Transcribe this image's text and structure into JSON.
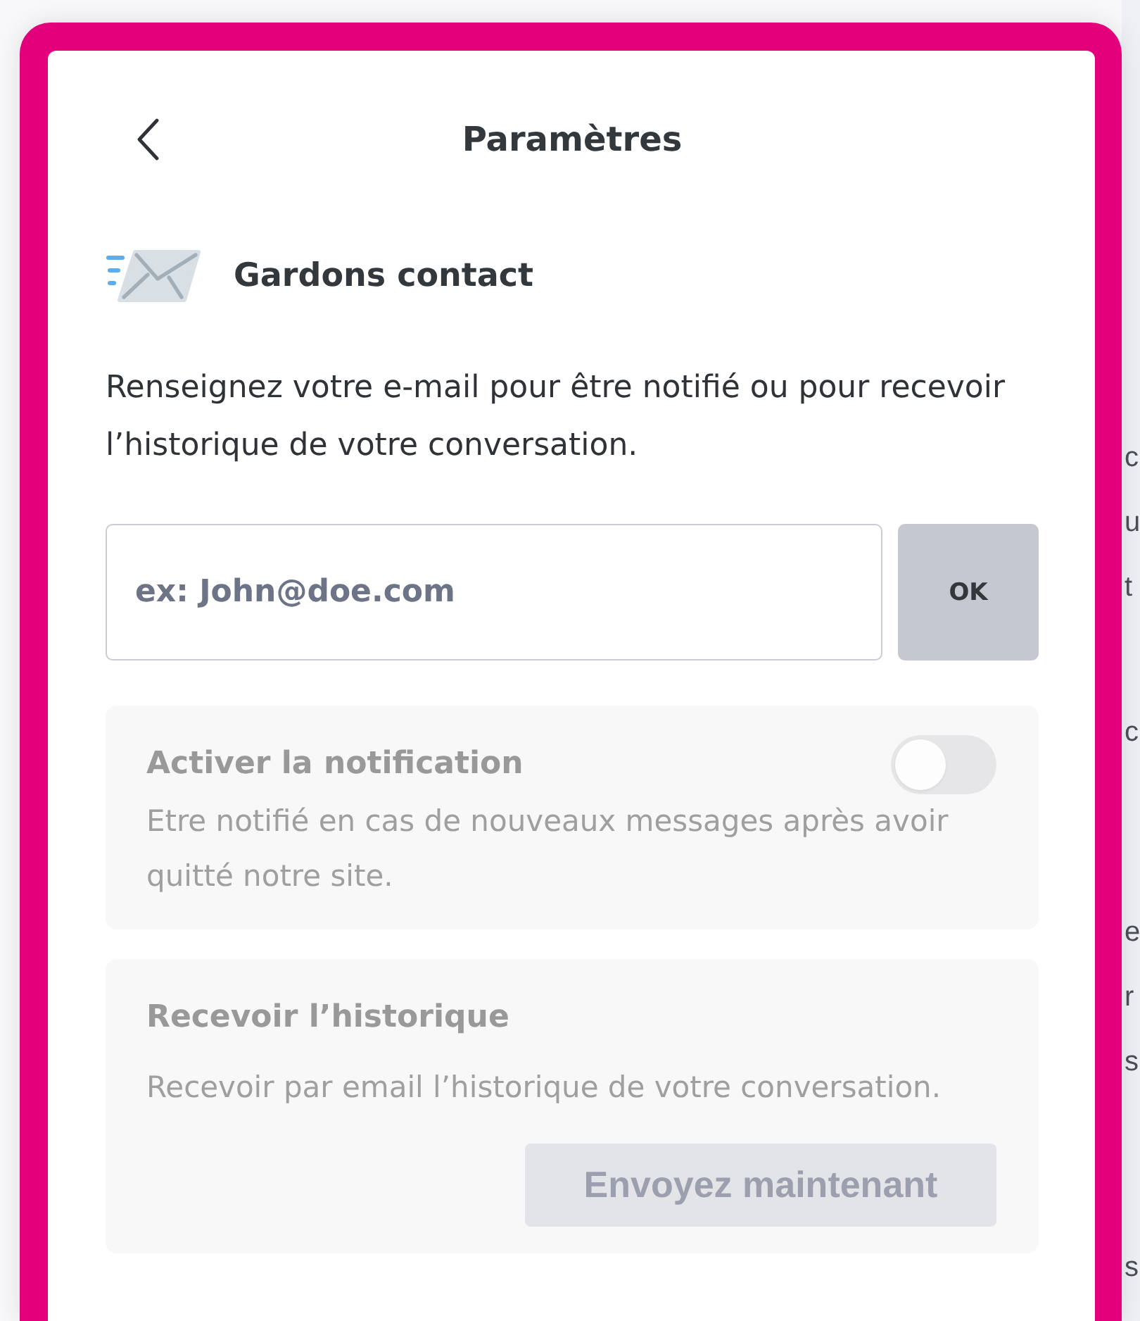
{
  "header": {
    "title": "Paramètres"
  },
  "contact": {
    "title": "Gardons contact",
    "description": "Renseignez votre e-mail pour être notifié ou pour recevoir l’historique de votre conversation.",
    "email_field": {
      "placeholder": "ex: John@doe.com"
    },
    "submit_button": "OK"
  },
  "settings": [
    {
      "kind": "toggle",
      "title": "Activer la notification",
      "description": "Etre notifié en cas de nouveaux messages après avoir quitté notre site.",
      "on": false,
      "disabled": true
    },
    {
      "kind": "action",
      "title": "Recevoir l’historique",
      "description": "Recevoir par email l’historique de votre conversation.",
      "button": "Envoyez maintenant",
      "disabled": true
    }
  ],
  "background_text": [
    [
      "c",
      "u",
      "t"
    ],
    [
      "c"
    ],
    [
      "e",
      "r",
      "s"
    ],
    [
      "s"
    ]
  ]
}
